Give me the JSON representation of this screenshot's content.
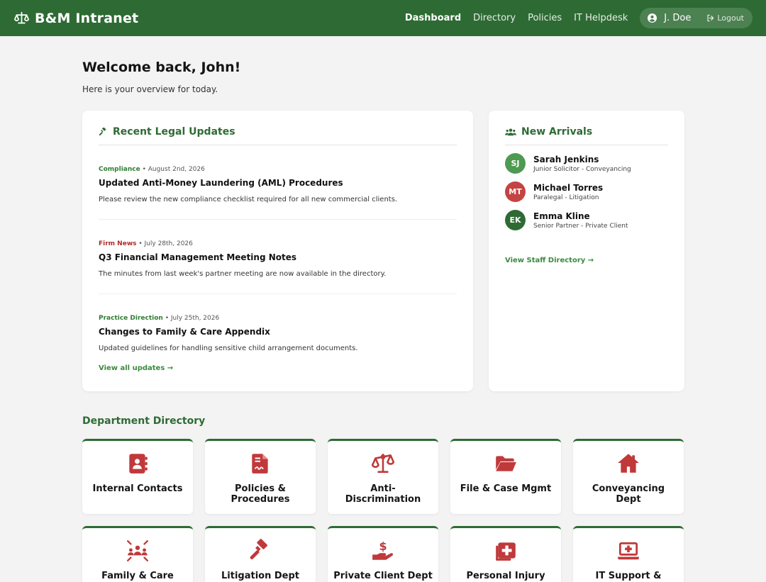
{
  "header": {
    "brand": "B&M Intranet",
    "nav": [
      "Dashboard",
      "Directory",
      "Policies",
      "IT Helpdesk"
    ],
    "user": "J. Doe",
    "logout": "Logout"
  },
  "welcome": {
    "title": "Welcome back, John!",
    "subtitle": "Here is your overview for today."
  },
  "updates": {
    "heading": "Recent Legal Updates",
    "items": [
      {
        "category": "Compliance",
        "date": " • August 2nd, 2026",
        "title": "Updated Anti-Money Laundering (AML) Procedures",
        "desc": "Please review the new compliance checklist required for all new commercial clients."
      },
      {
        "category": "Firm News",
        "date": " • July 28th, 2026",
        "title": "Q3 Financial Management Meeting Notes",
        "desc": "The minutes from last week's partner meeting are now available in the directory."
      },
      {
        "category": "Practice Direction",
        "date": " • July 25th, 2026",
        "title": "Changes to Family & Care Appendix",
        "desc": "Updated guidelines for handling sensitive child arrangement documents."
      }
    ],
    "link": "View all updates →"
  },
  "arrivals": {
    "heading": "New Arrivals",
    "people": [
      {
        "initials": "SJ",
        "name": "Sarah Jenkins",
        "role": "Junior Solicitor - Conveyancing",
        "color": "#4e9a52"
      },
      {
        "initials": "MT",
        "name": "Michael Torres",
        "role": "Paralegal - Litigation",
        "color": "#c44343"
      },
      {
        "initials": "EK",
        "name": "Emma Kline",
        "role": "Senior Partner - Private Client",
        "color": "#2e6b34"
      }
    ],
    "link": "View Staff Directory →"
  },
  "departments": {
    "heading": "Department Directory",
    "tiles": [
      {
        "label": "Internal Contacts",
        "icon": "address-book-icon"
      },
      {
        "label": "Policies & Procedures",
        "icon": "file-contract-icon"
      },
      {
        "label": "Anti-Discrimination",
        "icon": "scale-icon"
      },
      {
        "label": "File & Case Mgmt",
        "icon": "folder-open-icon"
      },
      {
        "label": "Conveyancing Dept",
        "icon": "house-icon"
      },
      {
        "label": "Family & Care Dept",
        "icon": "people-arrows-icon"
      },
      {
        "label": "Litigation Dept",
        "icon": "gavel-icon"
      },
      {
        "label": "Private Client Dept",
        "icon": "hand-holding-dollar-icon"
      },
      {
        "label": "Personal Injury",
        "icon": "medical-kit-icon"
      },
      {
        "label": "IT Support & Facilities",
        "icon": "laptop-medical-icon"
      }
    ]
  },
  "colors": {
    "brand": "#2e6b34",
    "accent_red": "#c44343",
    "link_green": "#3b8a3f"
  }
}
